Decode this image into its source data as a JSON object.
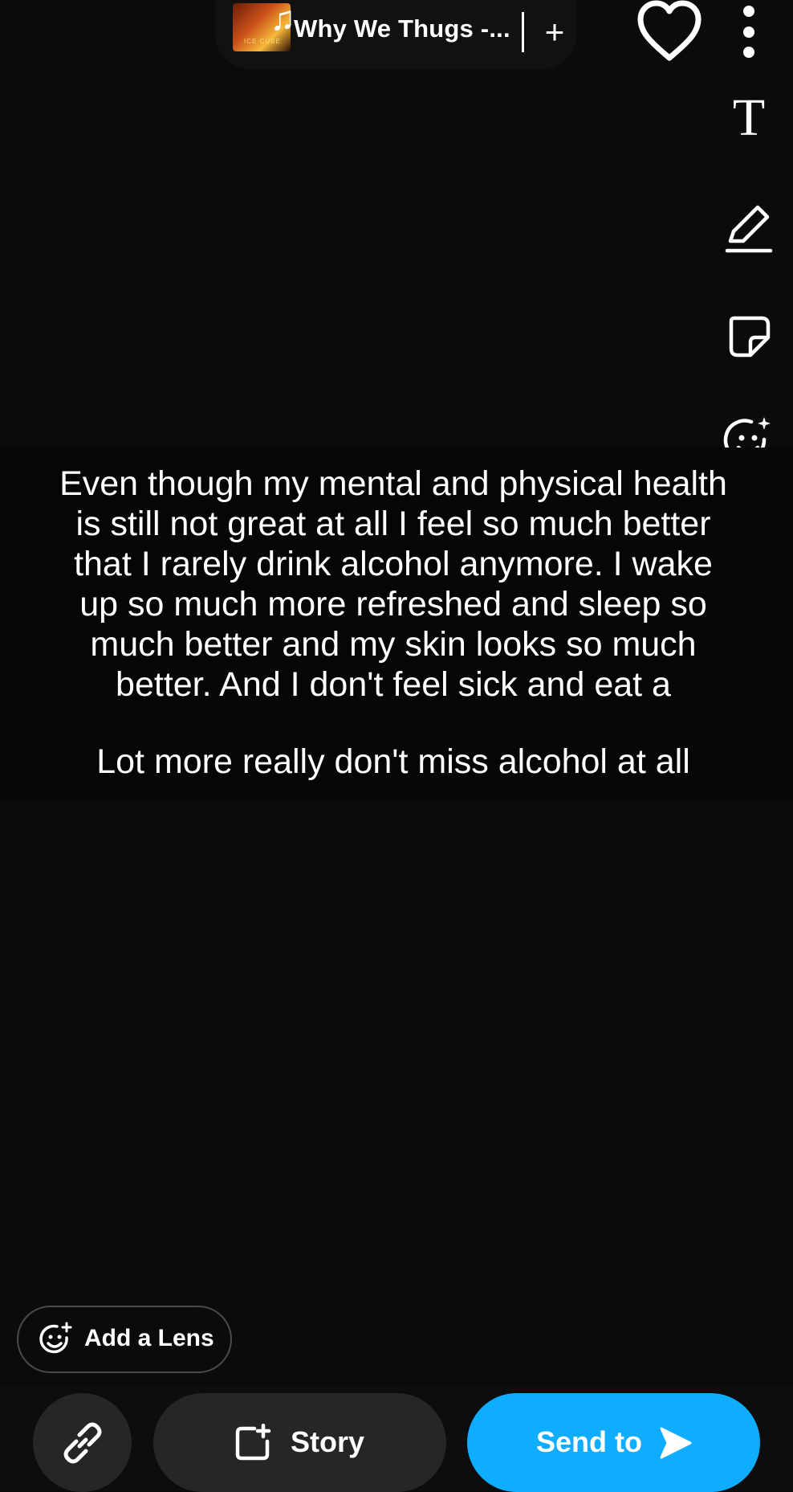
{
  "music": {
    "title": "Why We Thugs -...",
    "add_glyph": "+",
    "art_label": "ICE CUBE",
    "note_glyph": "♫"
  },
  "top_right": {
    "icons": [
      "heart-icon",
      "more-vertical-icon"
    ]
  },
  "right_rail": {
    "text_tool_glyph": "T",
    "icons": [
      "text-icon",
      "pencil-icon",
      "sticker-icon",
      "lens-sparkle-icon",
      "chevron-down-icon"
    ]
  },
  "caption": {
    "lines": [
      "Even though my mental and physical health",
      "is still not great at all I feel so much better",
      "that I rarely drink alcohol anymore. I wake",
      "up so much more refreshed and sleep so",
      "much better and my skin looks so much",
      "better. And I don't feel sick and eat a"
    ],
    "last_line": "Lot more really don't miss alcohol at all"
  },
  "lens_button": {
    "label": "Add a Lens"
  },
  "bottom_bar": {
    "story_label": "Story",
    "send_label": "Send to"
  },
  "colors": {
    "accent": "#0eadff",
    "background": "#0b0b0b",
    "button_dark": "#262626"
  }
}
